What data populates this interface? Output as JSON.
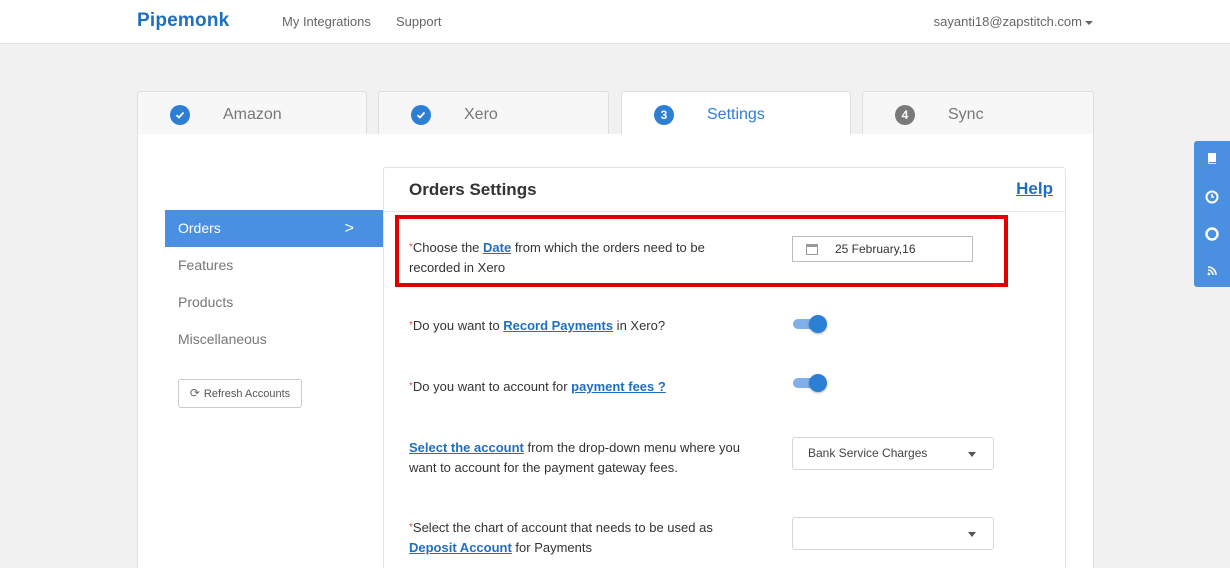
{
  "header": {
    "brand": "Pipemonk",
    "nav": [
      "My Integrations",
      "Support"
    ],
    "user_email": "sayanti18@zapstitch.com"
  },
  "steps": [
    {
      "number": "",
      "label": "Amazon",
      "state": "done"
    },
    {
      "number": "",
      "label": "Xero",
      "state": "done"
    },
    {
      "number": "3",
      "label": "Settings",
      "state": "active"
    },
    {
      "number": "4",
      "label": "Sync",
      "state": "pending"
    }
  ],
  "sidebar": {
    "items": [
      {
        "label": "Orders",
        "chevron": ">"
      },
      {
        "label": "Features"
      },
      {
        "label": "Products"
      },
      {
        "label": "Miscellaneous"
      }
    ],
    "refresh_label": "Refresh Accounts"
  },
  "settings": {
    "title": "Orders Settings",
    "help": "Help",
    "required_mark": "*",
    "q1": {
      "pre": "Choose the ",
      "link": "Date",
      "post": " from which the orders need to be recorded in Xero",
      "date_value": "25 February,16"
    },
    "q2": {
      "pre": "Do you want to ",
      "link": "Record Payments",
      "post": " in Xero?",
      "enabled": true
    },
    "q3": {
      "pre": "Do you want to account for ",
      "link": "payment fees ?",
      "post": "",
      "enabled": true
    },
    "q4": {
      "link": "Select the account",
      "post": " from the drop-down menu where you want to account for the payment gateway fees.",
      "selected": "Bank Service Charges"
    },
    "q5": {
      "pre": "Select the chart of account that needs to be used as ",
      "link": "Deposit Account",
      "post": " for Payments",
      "selected": ""
    }
  },
  "colors": {
    "accent": "#2d7fd6",
    "highlight": "#e00000"
  }
}
